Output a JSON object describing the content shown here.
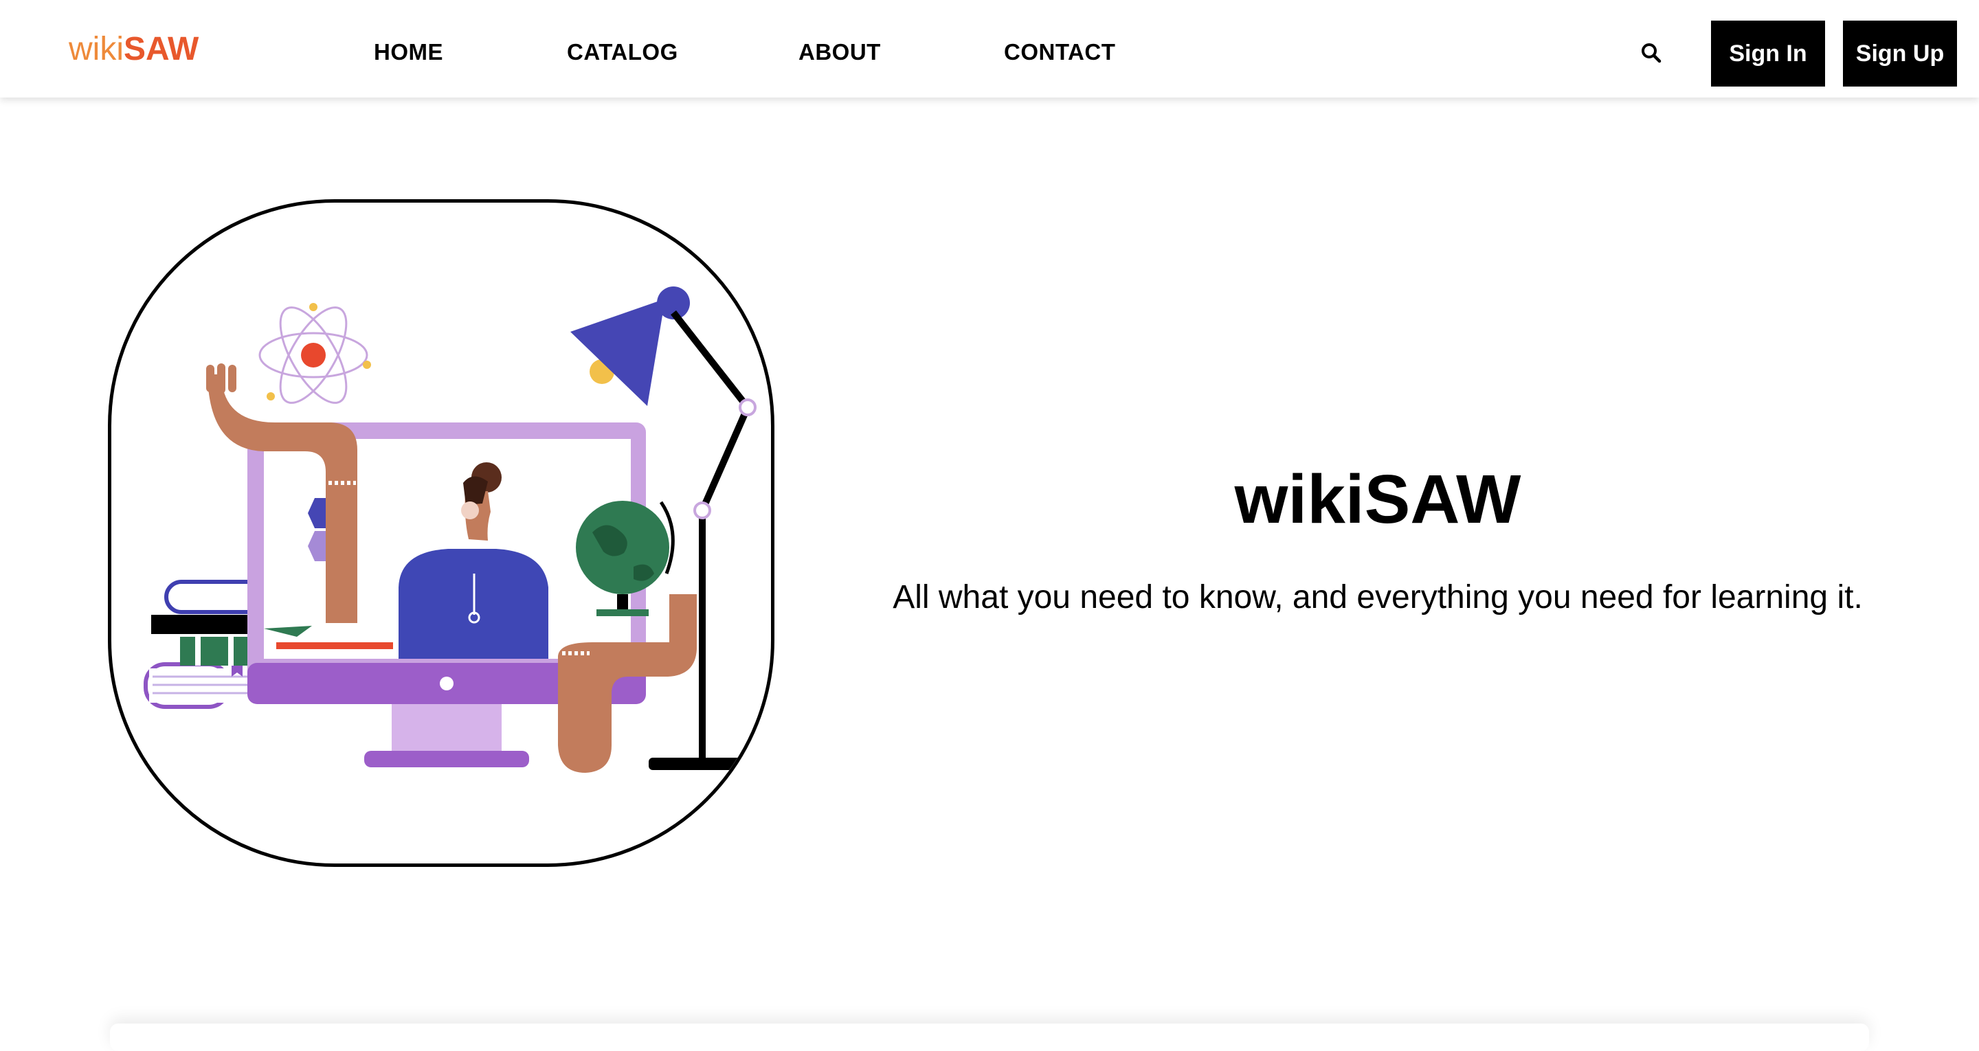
{
  "brand": {
    "logo_prefix": "wiki",
    "logo_suffix": "SAW",
    "prefix_color": "#ee8a3a",
    "suffix_color": "#e8582c"
  },
  "nav": {
    "items": [
      {
        "label": "HOME"
      },
      {
        "label": "CATALOG"
      },
      {
        "label": "ABOUT"
      },
      {
        "label": "CONTACT"
      }
    ],
    "search_icon": "search-icon",
    "sign_in_label": "Sign In",
    "sign_up_label": "Sign Up"
  },
  "hero": {
    "title": "wikiSAW",
    "tagline": "All what you need to know, and everything you need for learning it.",
    "illustration": "online-learning-illustration"
  }
}
